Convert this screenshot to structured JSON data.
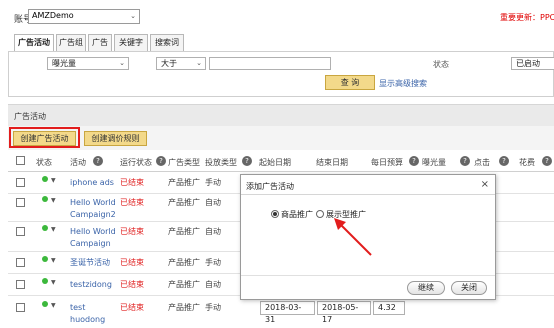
{
  "account": {
    "label": "账号",
    "value": "AMZDemo"
  },
  "notice": "重要更新：PPC",
  "tabs": [
    {
      "label": "广告活动",
      "active": true
    },
    {
      "label": "广告组",
      "active": false
    },
    {
      "label": "广告",
      "active": false
    },
    {
      "label": "关键字",
      "active": false
    },
    {
      "label": "搜索词",
      "active": false
    }
  ],
  "filter": {
    "metric": "曝光量",
    "operator": "大于",
    "value": "",
    "status_label": "状态",
    "status_value": "已启动",
    "query_button": "查 询",
    "advanced_link": "显示高级搜索"
  },
  "section": {
    "title": "广告活动",
    "create_campaign": "创建广告活动",
    "create_bid_rule": "创建调价规则"
  },
  "table": {
    "columns": [
      "状态",
      "活动",
      "运行状态",
      "广告类型",
      "投放类型",
      "起始日期",
      "结束日期",
      "每日预算",
      "曝光量",
      "点击",
      "花费"
    ],
    "rows": [
      {
        "name": "iphone ads",
        "run_status": "已结束",
        "ad_type": "产品推广",
        "targeting": "手动",
        "start": "",
        "end": "",
        "budget": ""
      },
      {
        "name": "Hello World Campaign2",
        "run_status": "已结束",
        "ad_type": "产品推广",
        "targeting": "自动",
        "start": "",
        "end": "",
        "budget": ""
      },
      {
        "name": "Hello World Campaign",
        "run_status": "已结束",
        "ad_type": "产品推广",
        "targeting": "自动",
        "start": "",
        "end": "",
        "budget": ""
      },
      {
        "name": "圣诞节活动",
        "run_status": "已结束",
        "ad_type": "产品推广",
        "targeting": "手动",
        "start": "",
        "end": "",
        "budget": ""
      },
      {
        "name": "testzidong",
        "run_status": "已结束",
        "ad_type": "产品推广",
        "targeting": "自动",
        "start": "",
        "end": "",
        "budget": ""
      },
      {
        "name": "test huodong",
        "run_status": "已结束",
        "ad_type": "产品推广",
        "targeting": "手动",
        "start": "2018-03-31",
        "end": "2018-05-17",
        "budget": "4.32"
      }
    ]
  },
  "modal": {
    "title": "添加广告活动",
    "close": "×",
    "option_product": "商品推广",
    "option_display": "展示型推广",
    "selected": "商品推广",
    "continue_button": "继续",
    "close_button": "关闭"
  },
  "colors": {
    "accent_red": "#e21d1d",
    "button_gold": "#f3d98a",
    "link_blue": "#3a63a8",
    "status_green": "#3cb83c"
  }
}
